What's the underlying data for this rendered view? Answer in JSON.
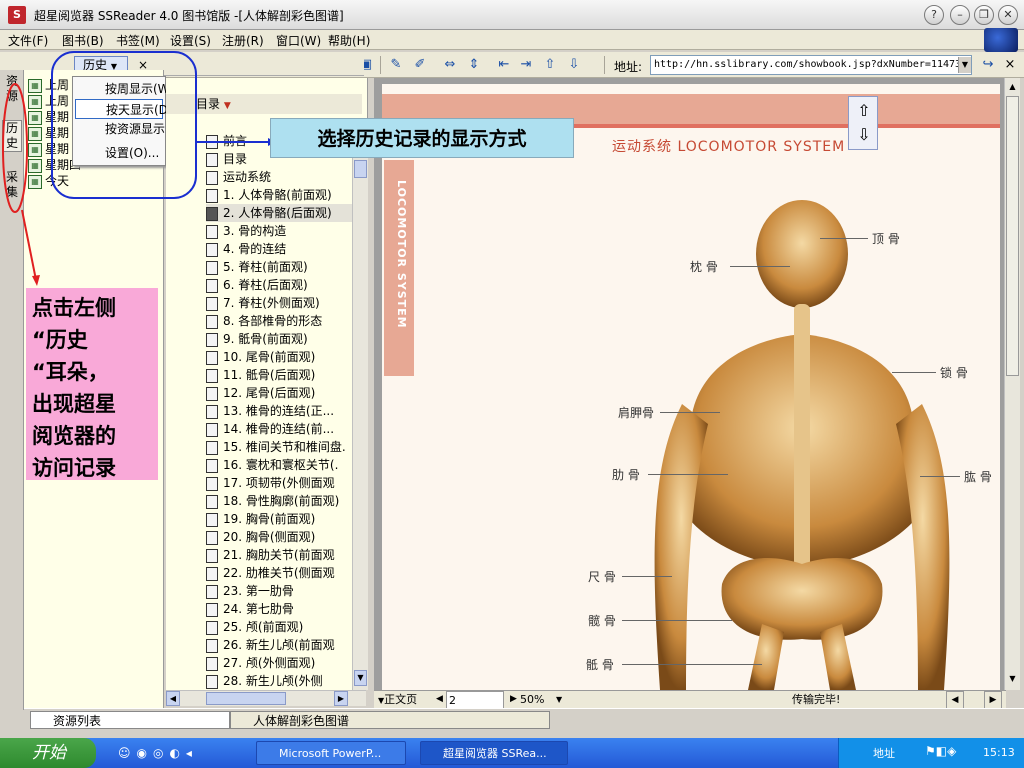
{
  "window": {
    "title": "超星阅览器 SSReader 4.0 图书馆版 -[人体解剖彩色图谱]",
    "icon": "ssreader-icon"
  },
  "menubar": {
    "items": [
      "文件(F)",
      "图书(B)",
      "书签(M)",
      "设置(S)",
      "注册(R)",
      "窗口(W)",
      "帮助(H)"
    ]
  },
  "toolbar": {
    "address_label": "地址:",
    "address_value": "http://hn.sslibrary.com/showbook.jsp?dxNumber=11473"
  },
  "vtabs": [
    "资源",
    "历史",
    "采集"
  ],
  "history_panel": {
    "button_label": "历史",
    "close_label": "×",
    "items": [
      "上周",
      "上周",
      "星期",
      "星期",
      "星期",
      "星期四",
      "今天"
    ]
  },
  "history_menu": {
    "items": [
      "按周显示(W)",
      "按天显示(D)",
      "按资源显示(S)",
      "设置(O)..."
    ],
    "selected_index": 1
  },
  "toc": {
    "header": "目录",
    "items": [
      "前言",
      "目录",
      "运动系统",
      "1. 人体骨骼(前面观)",
      "2. 人体骨骼(后面观)",
      "3. 骨的构造",
      "4. 骨的连结",
      "5. 脊柱(前面观)",
      "6. 脊柱(后面观)",
      "7. 脊柱(外侧面观)",
      "8. 各部椎骨的形态",
      "9. 骶骨(前面观)",
      "10. 尾骨(前面观)",
      "11. 骶骨(后面观)",
      "12. 尾骨(后面观)",
      "13. 椎骨的连结(正...",
      "14. 椎骨的连结(前...",
      "15. 椎间关节和椎间盘.",
      "16. 寰枕和寰枢关节(.",
      "17. 项韧带(外侧面观",
      "18. 骨性胸廓(前面观)",
      "19. 胸骨(前面观)",
      "20. 胸骨(侧面观)",
      "21. 胸肋关节(前面观",
      "22. 肋椎关节(侧面观",
      "23. 第一肋骨",
      "24. 第七肋骨",
      "25. 颅(前面观)",
      "26. 新生儿颅(前面观",
      "27. 颅(外侧面观)",
      "28. 新生儿颅(外侧"
    ],
    "selected_index": 4
  },
  "document": {
    "page_title": "运动系统  LOCOMOTOR SYSTEM",
    "vertical_title": "LOCOMOTOR SYSTEM",
    "labels": {
      "ding_gu": "顶 骨",
      "zhen_gu": "枕 骨",
      "suo_gu": "锁 骨",
      "jian_jia_gu": "肩胛骨",
      "lei_gu": "肋 骨",
      "gong_gu": "肱 骨",
      "chi_gu": "尺 骨",
      "qia_gu": "髋 骨",
      "di_gu": "骶 骨"
    }
  },
  "statusbar": {
    "view_label": "正文页",
    "page_number": "2",
    "zoom": "50%",
    "status_text": "传输完毕!"
  },
  "bottom_tabs": [
    "资源列表",
    "人体解剖彩色图谱"
  ],
  "taskbar": {
    "start_label": "开始",
    "tasks": [
      "Microsoft PowerP...",
      "超星阅览器 SSRea..."
    ],
    "address_label": "地址",
    "clock": "15:13"
  },
  "annotations": {
    "top_callout": "选择历史记录的显示方式",
    "left_callout": "点击左侧\n“历史\n“耳朵，\n出现超星\n阅览器的\n访问记录"
  },
  "colors": {
    "annotation_blue": "#1a2fd0",
    "annotation_red": "#e02020",
    "callout_top_bg": "#aee0f0",
    "callout_left_bg": "#f9a9d8",
    "page_band": "#e7a894"
  }
}
